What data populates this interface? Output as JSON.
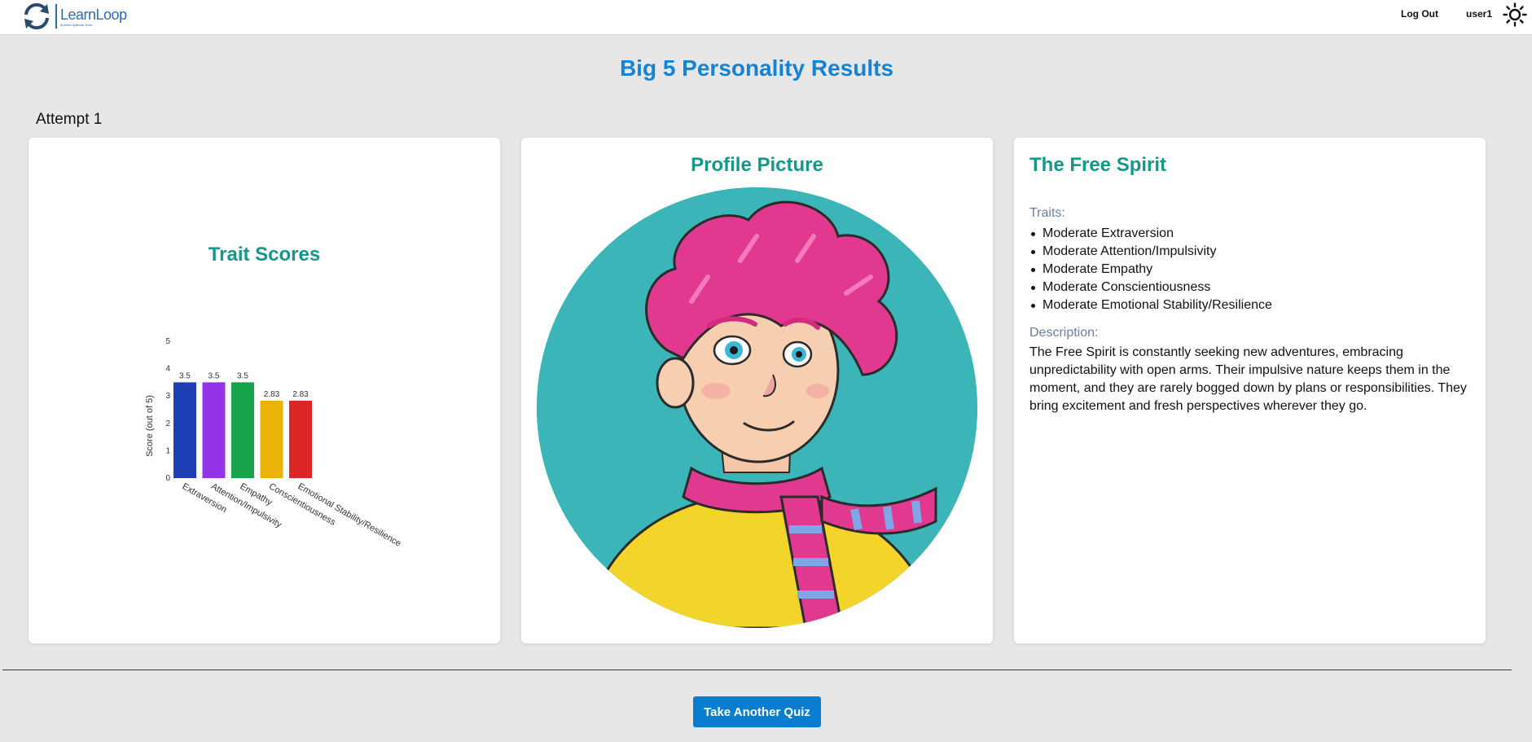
{
  "header": {
    "logo_name": "LearnLoop",
    "logo_tagline": "Modern Aptitude Tests",
    "logout_label": "Log Out",
    "username": "user1",
    "theme_icon": "sun-icon"
  },
  "page": {
    "title": "Big 5 Personality Results",
    "attempt_label": "Attempt 1",
    "cta_label": "Take Another Quiz"
  },
  "chart_card": {
    "title": "Trait Scores"
  },
  "chart_data": {
    "type": "bar",
    "title": "Trait Scores",
    "xlabel": "",
    "ylabel": "Score (out of 5)",
    "ylim": [
      0,
      5
    ],
    "yticks": [
      "0",
      "1",
      "2",
      "3",
      "4",
      "5"
    ],
    "categories": [
      "Extraversion",
      "Attention/Impulsivity",
      "Empathy",
      "Conscientiousness",
      "Emotional Stability/Resilience"
    ],
    "values": [
      3.5,
      3.5,
      3.5,
      2.83,
      2.83
    ],
    "value_labels": [
      "3.5",
      "3.5",
      "3.5",
      "2.83",
      "2.83"
    ],
    "colors": [
      "#1f3fb5",
      "#9333ea",
      "#16a34a",
      "#eab308",
      "#dc2626"
    ],
    "grid": false,
    "legend": "none"
  },
  "profile_card": {
    "title": "Profile Picture"
  },
  "persona_card": {
    "title": "The Free Spirit",
    "traits_label": "Traits:",
    "traits": [
      "Moderate Extraversion",
      "Moderate Attention/Impulsivity",
      "Moderate Empathy",
      "Moderate Conscientiousness",
      "Moderate Emotional Stability/Resilience"
    ],
    "description_label": "Description:",
    "description": "The Free Spirit is constantly seeking new adventures, embracing unpredictability with open arms. Their impulsive nature keeps them in the moment, and they are rarely bogged down by plans or responsibilities. They bring excitement and fresh perspectives wherever they go."
  }
}
